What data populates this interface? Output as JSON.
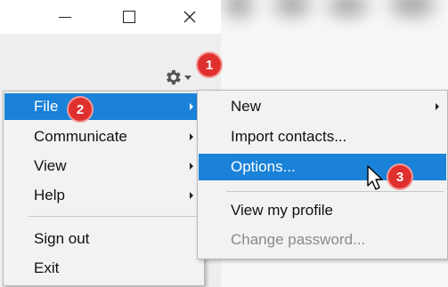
{
  "window": {
    "minimize_glyph": "—",
    "maximize_glyph": "☐",
    "close_glyph": "✕"
  },
  "main_menu": {
    "items": [
      {
        "label": "File",
        "has_submenu": true,
        "selected": true
      },
      {
        "label": "Communicate",
        "has_submenu": true
      },
      {
        "label": "View",
        "has_submenu": true
      },
      {
        "label": "Help",
        "has_submenu": true
      },
      {
        "label": "Sign out",
        "has_submenu": false
      },
      {
        "label": "Exit",
        "has_submenu": false
      }
    ]
  },
  "file_submenu": {
    "items": [
      {
        "label": "New",
        "has_submenu": true
      },
      {
        "label": "Import contacts...",
        "has_submenu": false
      },
      {
        "label": "Options...",
        "selected": true
      },
      {
        "label": "View my profile"
      },
      {
        "label": "Change password...",
        "disabled": true
      }
    ]
  },
  "badges": [
    "1",
    "2",
    "3"
  ],
  "icons": {
    "gear": "gear-icon",
    "cursor": "mouse-pointer-icon"
  },
  "colors": {
    "selection": "#1a82d8",
    "badge": "#e0302d",
    "menu_bg": "#f2f2f2"
  }
}
